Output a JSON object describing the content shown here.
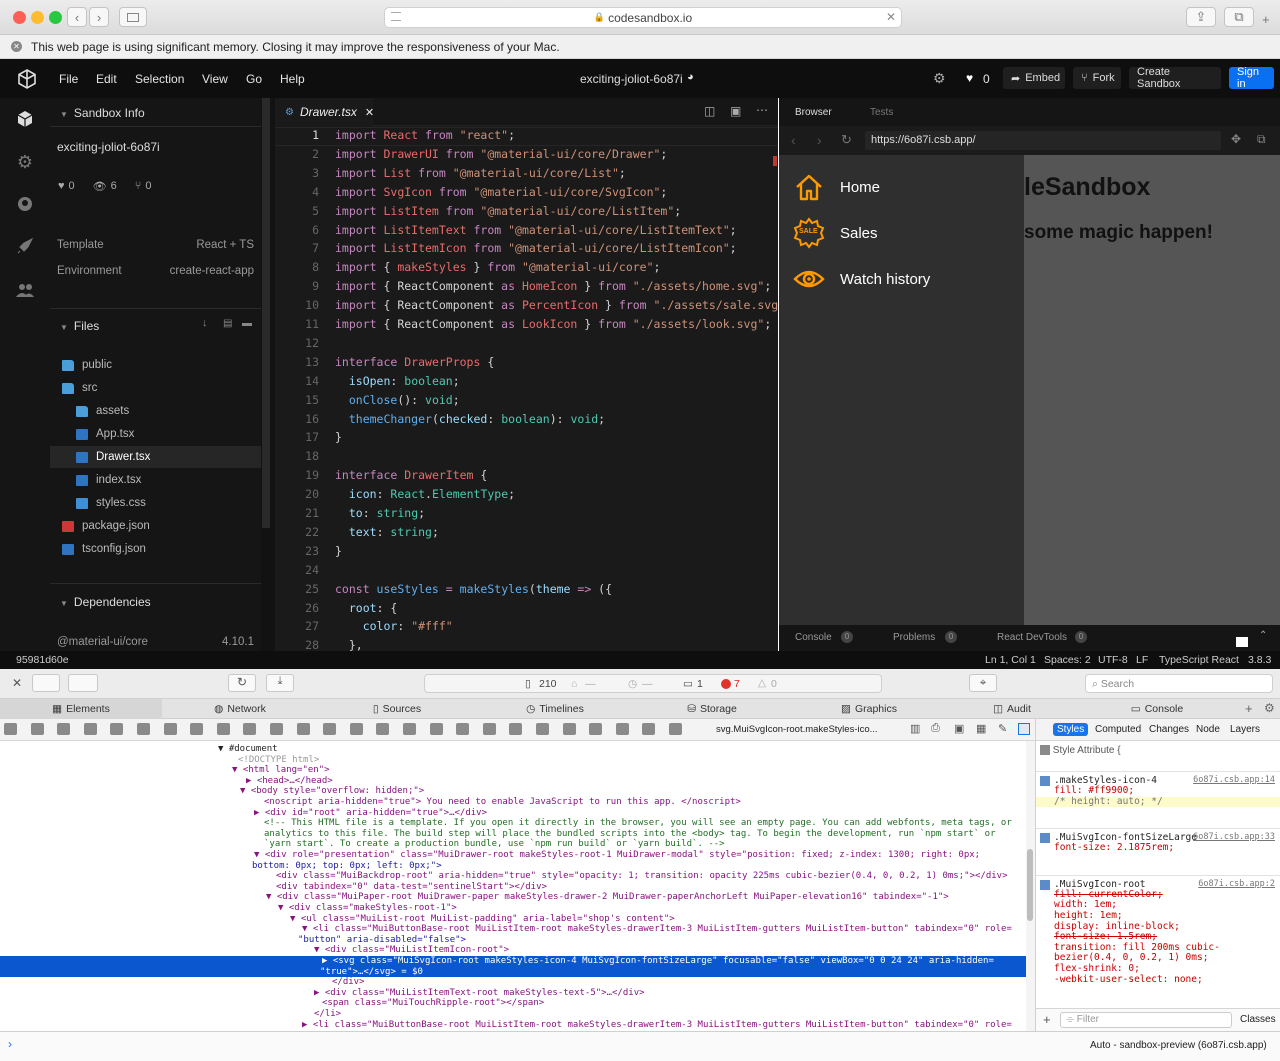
{
  "safari": {
    "url": "codesandbox.io",
    "memory_warning": "This web page is using significant memory. Closing it may improve the responsiveness of your Mac."
  },
  "menu": {
    "items": [
      "File",
      "Edit",
      "Selection",
      "View",
      "Go",
      "Help"
    ],
    "sandbox_title": "exciting-joliot-6o87i",
    "likes": "0",
    "embed": "Embed",
    "fork": "Fork",
    "create": "Create Sandbox",
    "signin": "Sign in"
  },
  "sidebar": {
    "info_title": "Sandbox Info",
    "sandbox_name": "exciting-joliot-6o87i",
    "likes": "0",
    "views": "6",
    "forks": "0",
    "template_label": "Template",
    "template_value": "React + TS",
    "env_label": "Environment",
    "env_value": "create-react-app",
    "files_title": "Files",
    "files": [
      {
        "name": "public",
        "type": "folder",
        "indent": 0
      },
      {
        "name": "src",
        "type": "folder-open",
        "indent": 0
      },
      {
        "name": "assets",
        "type": "folder",
        "indent": 1
      },
      {
        "name": "App.tsx",
        "type": "ts",
        "indent": 1
      },
      {
        "name": "Drawer.tsx",
        "type": "ts",
        "indent": 1,
        "active": true
      },
      {
        "name": "index.tsx",
        "type": "ts",
        "indent": 1
      },
      {
        "name": "styles.css",
        "type": "css",
        "indent": 1
      },
      {
        "name": "package.json",
        "type": "npm",
        "indent": 0
      },
      {
        "name": "tsconfig.json",
        "type": "ts",
        "indent": 0
      }
    ],
    "deps_title": "Dependencies",
    "dep_name": "@material-ui/core",
    "dep_version": "4.10.1"
  },
  "editor": {
    "tab": "Drawer.tsx",
    "lines": [
      [
        [
          "kw",
          "import "
        ],
        [
          "id",
          "React "
        ],
        [
          "kw",
          "from "
        ],
        [
          "st",
          "\"react\""
        ],
        [
          "",
          "; "
        ]
      ],
      [
        [
          "kw",
          "import "
        ],
        [
          "id",
          "DrawerUI "
        ],
        [
          "kw",
          "from "
        ],
        [
          "st",
          "\"@material-ui/core/Drawer\""
        ],
        [
          "",
          ";"
        ]
      ],
      [
        [
          "kw",
          "import "
        ],
        [
          "id",
          "List "
        ],
        [
          "kw",
          "from "
        ],
        [
          "st",
          "\"@material-ui/core/List\""
        ],
        [
          "",
          ";"
        ]
      ],
      [
        [
          "kw",
          "import "
        ],
        [
          "id",
          "SvgIcon "
        ],
        [
          "kw",
          "from "
        ],
        [
          "st",
          "\"@material-ui/core/SvgIcon\""
        ],
        [
          "",
          ";"
        ]
      ],
      [
        [
          "kw",
          "import "
        ],
        [
          "id",
          "ListItem "
        ],
        [
          "kw",
          "from "
        ],
        [
          "st",
          "\"@material-ui/core/ListItem\""
        ],
        [
          "",
          ";"
        ]
      ],
      [
        [
          "kw",
          "import "
        ],
        [
          "id",
          "ListItemText "
        ],
        [
          "kw",
          "from "
        ],
        [
          "st",
          "\"@material-ui/core/ListItemText\""
        ],
        [
          "",
          ";"
        ]
      ],
      [
        [
          "kw",
          "import "
        ],
        [
          "id",
          "ListItemIcon "
        ],
        [
          "kw",
          "from "
        ],
        [
          "st",
          "\"@material-ui/core/ListItemIcon\""
        ],
        [
          "",
          ";"
        ]
      ],
      [
        [
          "kw",
          "import "
        ],
        [
          "",
          "{ "
        ],
        [
          "id",
          "makeStyles "
        ],
        [
          "",
          "} "
        ],
        [
          "kw",
          "from "
        ],
        [
          "st",
          "\"@material-ui/core\""
        ],
        [
          "",
          ";"
        ]
      ],
      [
        [
          "kw",
          "import "
        ],
        [
          "",
          "{ ReactComponent "
        ],
        [
          "kw",
          "as "
        ],
        [
          "id",
          "HomeIcon "
        ],
        [
          "",
          "} "
        ],
        [
          "kw",
          "from "
        ],
        [
          "st",
          "\"./assets/home.svg\""
        ],
        [
          "",
          ";"
        ]
      ],
      [
        [
          "kw",
          "import "
        ],
        [
          "",
          "{ ReactComponent "
        ],
        [
          "kw",
          "as "
        ],
        [
          "id",
          "PercentIcon "
        ],
        [
          "",
          "} "
        ],
        [
          "kw",
          "from "
        ],
        [
          "st",
          "\"./assets/sale.svg\""
        ]
      ],
      [
        [
          "kw",
          "import "
        ],
        [
          "",
          "{ ReactComponent "
        ],
        [
          "kw",
          "as "
        ],
        [
          "id",
          "LookIcon "
        ],
        [
          "",
          "} "
        ],
        [
          "kw",
          "from "
        ],
        [
          "st",
          "\"./assets/look.svg\""
        ],
        [
          "",
          ";"
        ]
      ],
      [
        [
          "",
          ""
        ]
      ],
      [
        [
          "kw",
          "interface "
        ],
        [
          "id",
          "DrawerProps "
        ],
        [
          "",
          "{"
        ]
      ],
      [
        [
          "",
          "  "
        ],
        [
          "ty",
          "isOpen"
        ],
        [
          "",
          ": "
        ],
        [
          "tp",
          "boolean"
        ],
        [
          "",
          ";"
        ]
      ],
      [
        [
          "",
          "  "
        ],
        [
          "fn",
          "onClose"
        ],
        [
          "",
          "(): "
        ],
        [
          "tp",
          "void"
        ],
        [
          "",
          ";"
        ]
      ],
      [
        [
          "",
          "  "
        ],
        [
          "fn",
          "themeChanger"
        ],
        [
          "",
          "("
        ],
        [
          "ty",
          "checked"
        ],
        [
          "",
          ": "
        ],
        [
          "tp",
          "boolean"
        ],
        [
          "",
          "): "
        ],
        [
          "tp",
          "void"
        ],
        [
          "",
          ";"
        ]
      ],
      [
        [
          "",
          "}"
        ]
      ],
      [
        [
          "",
          ""
        ]
      ],
      [
        [
          "kw",
          "interface "
        ],
        [
          "id",
          "DrawerItem "
        ],
        [
          "",
          "{"
        ]
      ],
      [
        [
          "",
          "  "
        ],
        [
          "ty",
          "icon"
        ],
        [
          "",
          ": "
        ],
        [
          "tp",
          "React"
        ],
        [
          "",
          "."
        ],
        [
          "tp",
          "ElementType"
        ],
        [
          "",
          ";"
        ]
      ],
      [
        [
          "",
          "  "
        ],
        [
          "ty",
          "to"
        ],
        [
          "",
          ": "
        ],
        [
          "tp",
          "string"
        ],
        [
          "",
          ";"
        ]
      ],
      [
        [
          "",
          "  "
        ],
        [
          "ty",
          "text"
        ],
        [
          "",
          ": "
        ],
        [
          "tp",
          "string"
        ],
        [
          "",
          ";"
        ]
      ],
      [
        [
          "",
          "}"
        ]
      ],
      [
        [
          "",
          ""
        ]
      ],
      [
        [
          "kw",
          "const "
        ],
        [
          "fn",
          "useStyles "
        ],
        [
          "kw",
          "= "
        ],
        [
          "fn",
          "makeStyles"
        ],
        [
          "",
          "("
        ],
        [
          "ty",
          "theme "
        ],
        [
          "kw",
          "=> "
        ],
        [
          "",
          "({"
        ]
      ],
      [
        [
          "",
          "  "
        ],
        [
          "ty",
          "root"
        ],
        [
          "",
          ": {"
        ]
      ],
      [
        [
          "",
          "    "
        ],
        [
          "ty",
          "color"
        ],
        [
          "",
          ": "
        ],
        [
          "st",
          "\"#fff\""
        ]
      ],
      [
        [
          "",
          "  },"
        ]
      ]
    ]
  },
  "preview": {
    "tab_browser": "Browser",
    "tab_tests": "Tests",
    "url": "https://6o87i.csb.app/",
    "heading": "leSandbox",
    "subheading": "some magic happen!",
    "drawer_items": [
      "Home",
      "Sales",
      "Watch history"
    ],
    "sale_badge": "SALE",
    "console": "Console",
    "console_count": "0",
    "problems": "Problems",
    "problems_count": "0",
    "react_devtools": "React DevTools",
    "react_count": "0"
  },
  "status": {
    "commit": "95981d60e",
    "position": "Ln 1, Col 1",
    "spaces": "Spaces: 2",
    "encoding": "UTF-8",
    "eol": "LF",
    "language": "TypeScript React",
    "version": "3.8.3"
  },
  "devtools": {
    "resources": "210",
    "resources_dash": "—",
    "time_dash": "—",
    "messages": "1",
    "errors": "7",
    "warnings": "0",
    "search_placeholder": "Search",
    "tabs": [
      "Elements",
      "Network",
      "Sources",
      "Timelines",
      "Storage",
      "Graphics",
      "Audit",
      "Console"
    ],
    "breadcrumb_last": "svg.MuiSvgIcon-root.makeStyles-ico...",
    "style_tabs": [
      "Styles",
      "Computed",
      "Changes",
      "Node",
      "Layers"
    ],
    "style_attribute": "Style Attribute",
    "rules": [
      {
        "selector": ".makeStyles-icon-4",
        "source": "6o87i.csb.app:14",
        "props": [
          "fill: #ff9900;",
          "/* height: auto; */"
        ]
      },
      {
        "selector": ".MuiSvgIcon-fontSizeLarge",
        "source": "6o87i.csb.app:33",
        "props": [
          "font-size: 2.1875rem;"
        ]
      },
      {
        "selector": ".MuiSvgIcon-root",
        "source": "6o87i.csb.app:2",
        "props": [
          "fill: currentColor;",
          "width: 1em;",
          "height: 1em;",
          "display: inline-block;",
          "font-size: 1.5rem;",
          "transition: fill 200ms cubic-",
          "bezier(0.4, 0, 0.2, 1) 0ms;",
          "flex-shrink: 0;",
          "-webkit-user-select: none;"
        ]
      }
    ],
    "filter_placeholder": "Filter",
    "classes": "Classes",
    "context": "Auto - sandbox-preview (6o87i.csb.app)",
    "dom_lines": [
      {
        "indent": 218,
        "text": "▼ #document",
        "cls": ""
      },
      {
        "indent": 238,
        "text": "<!DOCTYPE html>",
        "cls": "cm2"
      },
      {
        "indent": 232,
        "text": "▼ <html lang=\"en\">",
        "cls": "tag"
      },
      {
        "indent": 246,
        "text": "▶ <head>…</head>",
        "cls": "tag"
      },
      {
        "indent": 240,
        "text": "▼ <body style=\"overflow: hidden;\">",
        "cls": "tag"
      },
      {
        "indent": 264,
        "text": "<noscript aria-hidden=\"true\"> You need to enable JavaScript to run this app. </noscript>",
        "cls": "tag"
      },
      {
        "indent": 254,
        "text": "▶ <div id=\"root\" aria-hidden=\"true\">…</div>",
        "cls": "tag"
      },
      {
        "indent": 264,
        "text": "<!-- This HTML file is a template. If you open it directly in the browser, you will see an empty page. You can add webfonts, meta tags, or",
        "cls": "cm"
      },
      {
        "indent": 264,
        "text": "analytics to this file. The build step will place the bundled scripts into the <body> tag. To begin the development, run `npm start` or",
        "cls": "cm"
      },
      {
        "indent": 264,
        "text": "`yarn start`. To create a production bundle, use `npm run build` or `yarn build`. -->",
        "cls": "cm"
      },
      {
        "indent": 254,
        "text": "▼ <div role=\"presentation\" class=\"MuiDrawer-root makeStyles-root-1 MuiDrawer-modal\" style=\"position: fixed; z-index: 1300; right: 0px;",
        "cls": "tag"
      },
      {
        "indent": 252,
        "text": "bottom: 0px; top: 0px; left: 0px;\">",
        "cls": "val"
      },
      {
        "indent": 276,
        "text": "<div class=\"MuiBackdrop-root\" aria-hidden=\"true\" style=\"opacity: 1; transition: opacity 225ms cubic-bezier(0.4, 0, 0.2, 1) 0ms;\"></div>",
        "cls": "tag"
      },
      {
        "indent": 276,
        "text": "<div tabindex=\"0\" data-test=\"sentinelStart\"></div>",
        "cls": "tag"
      },
      {
        "indent": 266,
        "text": "▼ <div class=\"MuiPaper-root MuiDrawer-paper makeStyles-drawer-2 MuiDrawer-paperAnchorLeft MuiPaper-elevation16\" tabindex=\"-1\">",
        "cls": "tag"
      },
      {
        "indent": 278,
        "text": "▼ <div class=\"makeStyles-root-1\">",
        "cls": "tag"
      },
      {
        "indent": 290,
        "text": "▼ <ul class=\"MuiList-root MuiList-padding\" aria-label=\"shop's content\">",
        "cls": "tag"
      },
      {
        "indent": 302,
        "text": "▼ <li class=\"MuiButtonBase-root MuiListItem-root makeStyles-drawerItem-3 MuiListItem-gutters MuiListItem-button\" tabindex=\"0\" role=",
        "cls": "tag"
      },
      {
        "indent": 298,
        "text": "\"button\" aria-disabled=\"false\">",
        "cls": "val"
      },
      {
        "indent": 314,
        "text": "▼ <div class=\"MuiListItemIcon-root\">",
        "cls": "tag"
      },
      {
        "indent": 322,
        "text": "▶ <svg class=\"MuiSvgIcon-root makeStyles-icon-4 MuiSvgIcon-fontSizeLarge\" focusable=\"false\" viewBox=\"0 0 24 24\" aria-hidden=",
        "cls": "sel"
      },
      {
        "indent": 320,
        "text": "\"true\">…</svg> = $0",
        "cls": "sel"
      },
      {
        "indent": 332,
        "text": "</div>",
        "cls": "tag"
      },
      {
        "indent": 314,
        "text": "▶ <div class=\"MuiListItemText-root makeStyles-text-5\">…</div>",
        "cls": "tag"
      },
      {
        "indent": 322,
        "text": "<span class=\"MuiTouchRipple-root\"></span>",
        "cls": "tag"
      },
      {
        "indent": 314,
        "text": "</li>",
        "cls": "tag"
      },
      {
        "indent": 302,
        "text": "▶ <li class=\"MuiButtonBase-root MuiListItem-root makeStyles-drawerItem-3 MuiListItem-gutters MuiListItem-button\" tabindex=\"0\" role=",
        "cls": "tag"
      }
    ]
  },
  "colors": {
    "accent_blue": "#0971f1",
    "orange": "#ff9900",
    "selection": "#0b57d0"
  }
}
